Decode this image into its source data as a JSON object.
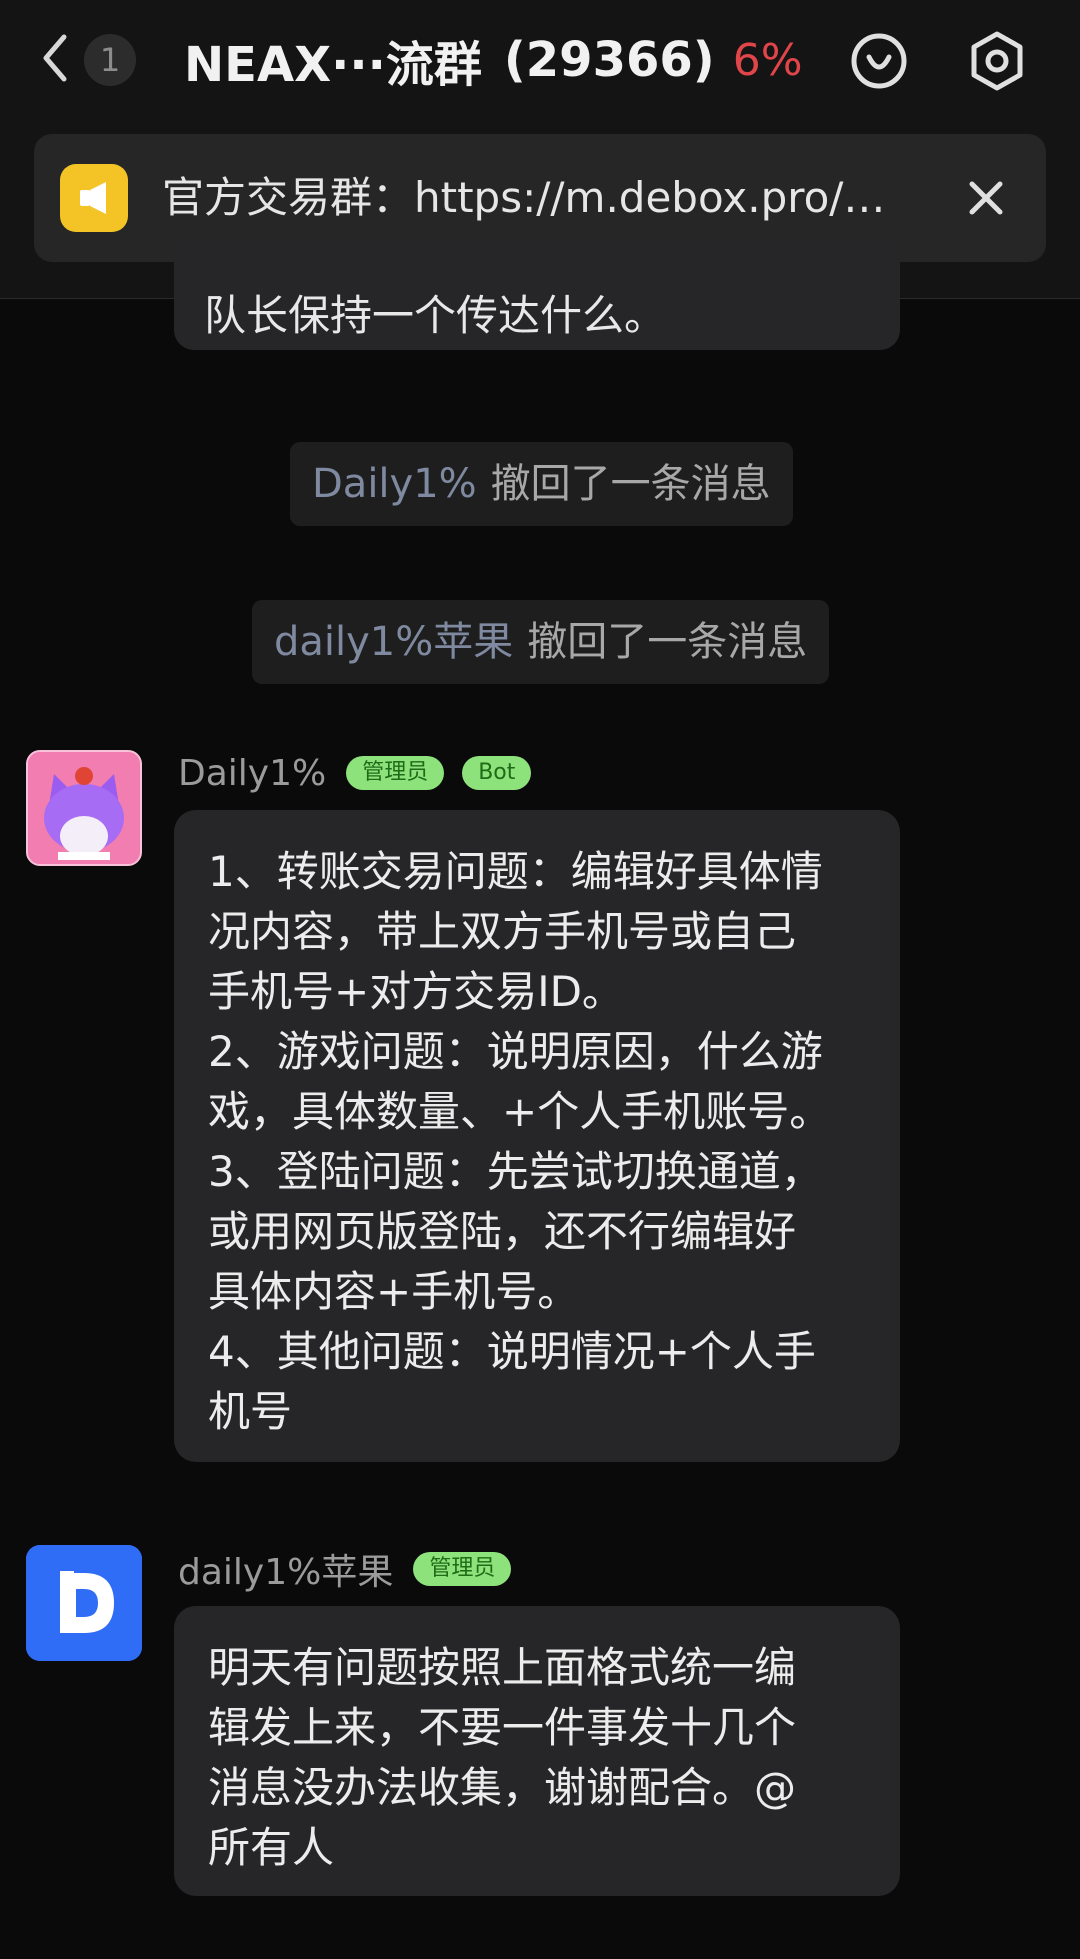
{
  "header": {
    "unread_count": "1",
    "title": "NEAX···流群",
    "member_count": "(29366)",
    "percent_fragment": "6%"
  },
  "announcement": {
    "text": "官方交易群：https://m.debox.pro/…"
  },
  "partial_message": {
    "text": "队长保持一个传达什么。"
  },
  "system_messages": [
    {
      "name": "Daily1%",
      "text": "撤回了一条消息"
    },
    {
      "name": "daily1%苹果",
      "text": "撤回了一条消息"
    }
  ],
  "messages": [
    {
      "sender": "Daily1%",
      "tags": [
        "管理员",
        "Bot"
      ],
      "lines": [
        "1、转账交易问题：编辑好具体情",
        "况内容，带上双方手机号或自己",
        "手机号+对方交易ID。",
        "2、游戏问题：说明原因，什么游",
        "戏，具体数量、+个人手机账号。",
        "3、登陆问题：先尝试切换通道，",
        "或用网页版登陆，还不行编辑好",
        "具体内容+手机号。",
        "4、其他问题：说明情况+个人手",
        "机号"
      ]
    },
    {
      "sender": "daily1%苹果",
      "tags": [
        "管理员"
      ],
      "lines": [
        "明天有问题按照上面格式统一编",
        "辑发上来，不要一件事发十几个",
        "消息没办法收集，谢谢配合。@",
        "所有人"
      ]
    }
  ],
  "icons": {
    "back": "back-chevron-icon",
    "emoji": "emoji-icon",
    "settings": "settings-icon",
    "announcement": "megaphone-icon",
    "close": "close-icon"
  },
  "colors": {
    "background": "#0a0a0a",
    "bubble": "#262628",
    "tag_bg": "#8ee27b",
    "tag_text": "#1f6b17",
    "percent_red": "#e0454a",
    "announce_icon": "#f4c427",
    "avatar_blue": "#2f6df6",
    "avatar_pink": "#f27db0"
  }
}
